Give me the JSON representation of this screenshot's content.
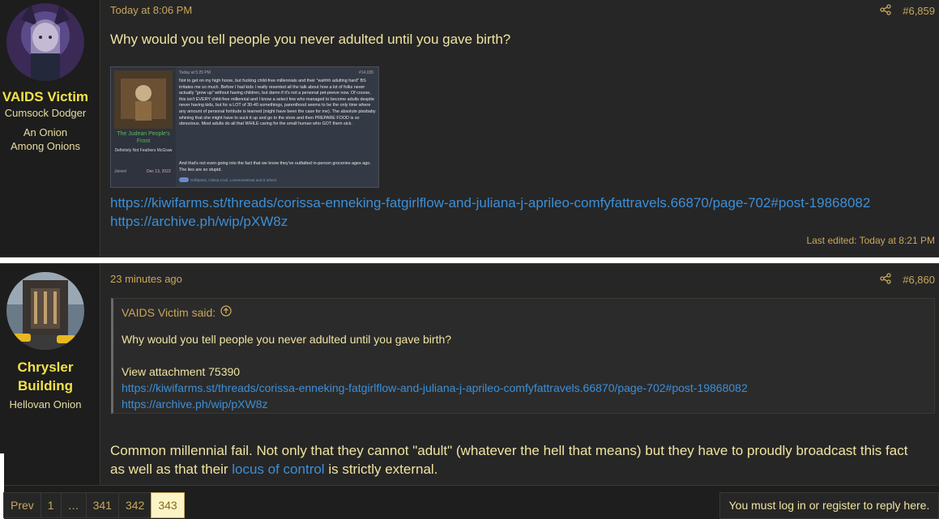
{
  "posts": [
    {
      "author": "VAIDS Victim",
      "title_line1": "Cumsock Dodger",
      "title_line2": "An Onion Among Onions",
      "time": "Today at 8:06 PM",
      "number": "#6,859",
      "body": "Why would you tell people you never adulted until you gave birth?",
      "link1": "https://kiwifarms.st/threads/corissa-enneking-fatgirlflow-and-juliana-j-aprileo-comfyfattravels.66870/page-702#post-19868082",
      "link2": "https://archive.ph/wip/pXW8z",
      "edited": "Last edited: Today at 8:21 PM",
      "thumb": {
        "header_time": "Today at 5:25 PM",
        "header_num": "#14,035",
        "group_name": "The Judean People's Front",
        "sub": "Definitely Not Feathers McGraw",
        "joined_label": "Joined",
        "joined_val": "Dec 13, 2022",
        "para1": "Not to get on my high horse, but fucking child-free millennials and their \"wahhh adulting hard\" BS irritates me so much. Before I had kids I really resented all the talk about how a lot of folks never actually \"grow up\" without having children, but damn if it's not a personal pet-peeve now. Of course, this isn't EVERY child-free millennial and I know a select few who managed to become adults despite never having kids, but for a LOT of 30-40 somethings, parenthood seems to be the only time where any amount of personal fortitude is learned (might have been the case for me). The absolute pissbaby whining that she might have to suck it up and go to the store and then PREPARE FOOD is so obnoxious. Most adults do all that WHILE caring for the small human who GOT them sick.",
        "para2": "And that's not even going into the fact that we know they've outfatted in-person groceries ages ago. The lies are so stupid.",
        "reactions": "Griffpatris, Clotsa Cool, LonesomeDust and 5 others"
      }
    },
    {
      "author_line1": "Chrysler",
      "author_line2": "Building",
      "title_line1": "Hellovan Onion",
      "time": "23 minutes ago",
      "number": "#6,860",
      "quote_author": "VAIDS Victim said:",
      "quote_text": "Why would you tell people you never adulted until you gave birth?",
      "quote_attachment": "View attachment 75390",
      "quote_link1": "https://kiwifarms.st/threads/corissa-enneking-fatgirlflow-and-juliana-j-aprileo-comfyfattravels.66870/page-702#post-19868082",
      "quote_link2": "https://archive.ph/wip/pXW8z",
      "body_before": "Common millennial fail. Not only that they cannot \"adult\" (whatever the hell that means) but they have to proudly broadcast this fact as well as that their ",
      "body_link": "locus of control",
      "body_after": " is strictly external."
    }
  ],
  "pagination": {
    "prev": "Prev",
    "pages": [
      "1",
      "…",
      "341",
      "342",
      "343"
    ],
    "current": "343"
  },
  "reply_note": "You must log in or register to reply here.",
  "colors": {
    "accent": "#c9a75a",
    "username": "#f2e24a",
    "link": "#3c8fd8",
    "post_bg": "#262626"
  }
}
